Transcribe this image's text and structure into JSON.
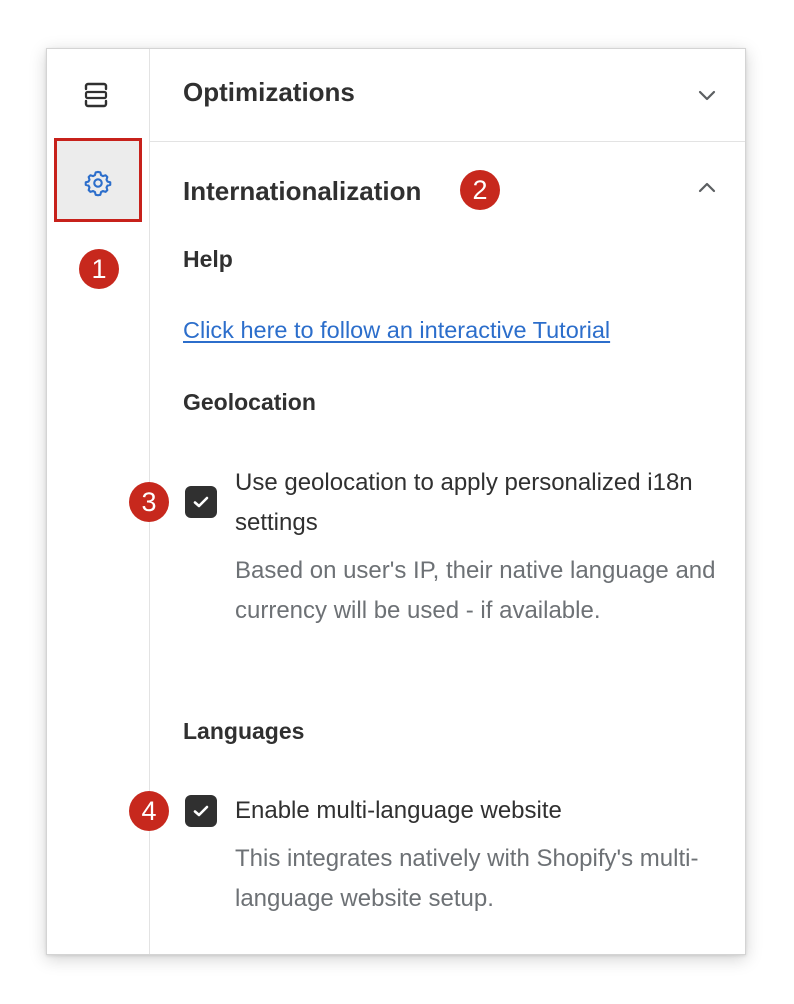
{
  "rail": {
    "icons": [
      "sections-icon",
      "gear-icon"
    ],
    "active": "gear-icon"
  },
  "badges": [
    "1",
    "2",
    "3",
    "4"
  ],
  "sections": {
    "optimizations": {
      "title": "Optimizations",
      "expanded": false
    },
    "internationalization": {
      "title": "Internationalization",
      "expanded": true
    }
  },
  "help": {
    "heading": "Help",
    "link_text": "Click here to follow an interactive Tutorial"
  },
  "geolocation": {
    "heading": "Geolocation",
    "checkbox_checked": true,
    "label": "Use geolocation to apply personalized i18n settings",
    "help": "Based on user's IP, their native language and currency will be used - if available."
  },
  "languages": {
    "heading": "Languages",
    "checkbox_checked": true,
    "label": "Enable multi-language website",
    "help": "This integrates natively with Shopify's multi-language website setup."
  },
  "colors": {
    "accent": "#2c6ecb",
    "annotation": "#c7281d",
    "text": "#303030",
    "subdued": "#6d7175"
  }
}
